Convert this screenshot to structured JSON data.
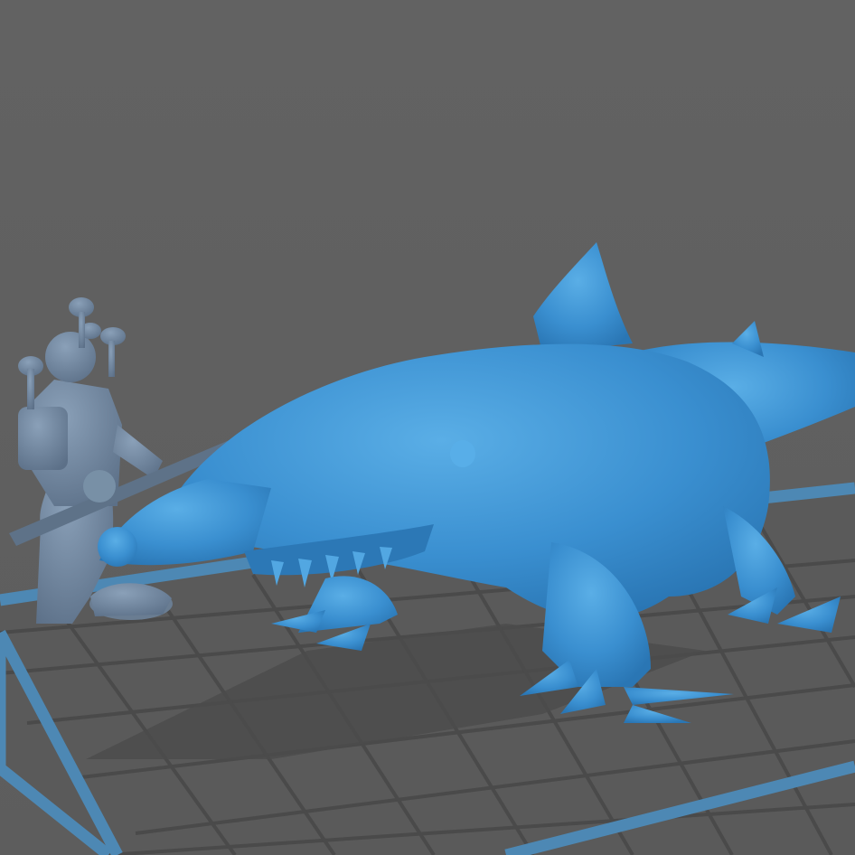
{
  "viewport": {
    "background": "#5f5f5f",
    "bed_plate_color": "#5a5a5a",
    "bed_grid_color": "#4a4a4a",
    "bed_border_color": "#4d88b4",
    "mini_color": "#6e8299",
    "creature_color": "#3b8fd0",
    "shadow_color": "#4b4b4b"
  },
  "objects": [
    {
      "name": "soldier-miniature",
      "description_icon": "miniature-model-icon"
    },
    {
      "name": "shark-beast-miniature",
      "description_icon": "miniature-model-icon"
    }
  ]
}
